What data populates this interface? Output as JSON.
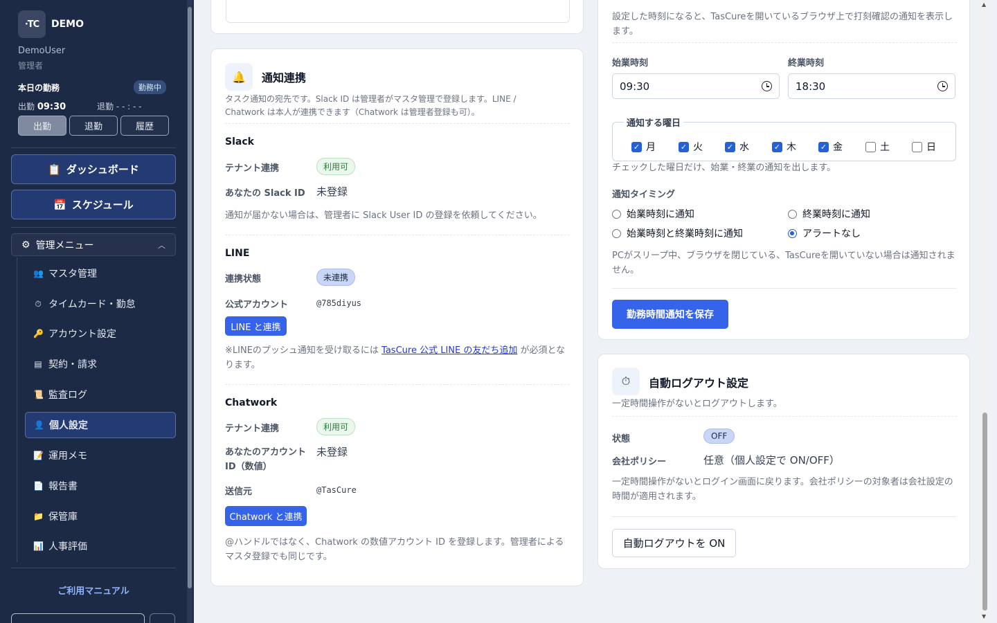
{
  "sidebar": {
    "logo_text": "·TC",
    "brand": "DEMO",
    "user_name": "DemoUser",
    "user_role": "管理者",
    "attendance_title": "本日の勤務",
    "attendance_badge": "勤務中",
    "clock_in_label": "出勤",
    "clock_in_time": "09:30",
    "clock_out_label": "退勤",
    "clock_out_time": "- - : - -",
    "buttons": {
      "clock_in": "出勤",
      "clock_out": "退勤",
      "history": "履歴"
    },
    "dashboard": "ダッシュボード",
    "schedule": "スケジュール",
    "admin_menu": "管理メニュー",
    "menu_items": [
      {
        "label": "マスタ管理",
        "icon": "👥"
      },
      {
        "label": "タイムカード・勤怠",
        "icon": "⏱"
      },
      {
        "label": "アカウント設定",
        "icon": "🔑"
      },
      {
        "label": "契約・請求",
        "icon": "▤"
      },
      {
        "label": "監査ログ",
        "icon": "📜"
      },
      {
        "label": "個人設定",
        "icon": "👤"
      },
      {
        "label": "運用メモ",
        "icon": "📝"
      },
      {
        "label": "報告書",
        "icon": "📄"
      },
      {
        "label": "保管庫",
        "icon": "📁"
      },
      {
        "label": "人事評価",
        "icon": "📊"
      }
    ],
    "active_item": "個人設定",
    "manual": "ご利用マニュアル"
  },
  "notify": {
    "title": "通知連携",
    "desc": "タスク通知の宛先です。Slack ID は管理者がマスタ管理で登録します。LINE / Chatwork は本人が連携できます（Chatwork は管理者登録も可）。",
    "slack": {
      "heading": "Slack",
      "tenant_label": "テナント連携",
      "tenant_value": "利用可",
      "id_label": "あなたの Slack ID",
      "id_value": "未登録",
      "note": "通知が届かない場合は、管理者に Slack User ID の登録を依頼してください。"
    },
    "line": {
      "heading": "LINE",
      "status_label": "連携状態",
      "status_value": "未連携",
      "account_label": "公式アカウント",
      "account_value": "@785diyus",
      "button": "LINE と連携",
      "note_prefix": "※LINEのプッシュ通知を受け取るには ",
      "note_link": "TasCure 公式 LINE の友だち追加",
      "note_suffix": " が必須となります。"
    },
    "chatwork": {
      "heading": "Chatwork",
      "tenant_label": "テナント連携",
      "tenant_value": "利用可",
      "id_label": "あなたのアカウント ID（数値）",
      "id_value": "未登録",
      "sender_label": "送信元",
      "sender_value": "@TasCure",
      "button": "Chatwork と連携",
      "note": "@ハンドルではなく、Chatwork の数値アカウント ID を登録します。管理者によるマスタ登録でも同じです。"
    }
  },
  "worktime": {
    "desc": "設定した時刻になると、TasCureを開いているブラウザ上で打刻確認の通知を表示します。",
    "start_label": "始業時刻",
    "start_value": "09:30",
    "end_label": "終業時刻",
    "end_value": "18:30",
    "days_legend": "通知する曜日",
    "days": [
      {
        "label": "月",
        "checked": true
      },
      {
        "label": "火",
        "checked": true
      },
      {
        "label": "水",
        "checked": true
      },
      {
        "label": "木",
        "checked": true
      },
      {
        "label": "金",
        "checked": true
      },
      {
        "label": "土",
        "checked": false
      },
      {
        "label": "日",
        "checked": false
      }
    ],
    "days_note": "チェックした曜日だけ、始業・終業の通知を出します。",
    "timing_label": "通知タイミング",
    "timing_options": [
      {
        "label": "始業時刻に通知",
        "selected": false
      },
      {
        "label": "終業時刻に通知",
        "selected": false
      },
      {
        "label": "始業時刻と終業時刻に通知",
        "selected": false
      },
      {
        "label": "アラートなし",
        "selected": true
      }
    ],
    "timing_note": "PCがスリープ中、ブラウザを閉じている、TasCureを開いていない場合は通知されません。",
    "save_button": "勤務時間通知を保存"
  },
  "autologout": {
    "title": "自動ログアウト設定",
    "desc": "一定時間操作がないとログアウトします。",
    "status_label": "状態",
    "status_value": "OFF",
    "policy_label": "会社ポリシー",
    "policy_value": "任意（個人設定で ON/OFF）",
    "note": "一定時間操作がないとログイン画面に戻ります。会社ポリシーの対象者は会社設定の時間が適用されます。",
    "button": "自動ログアウトを ON"
  }
}
